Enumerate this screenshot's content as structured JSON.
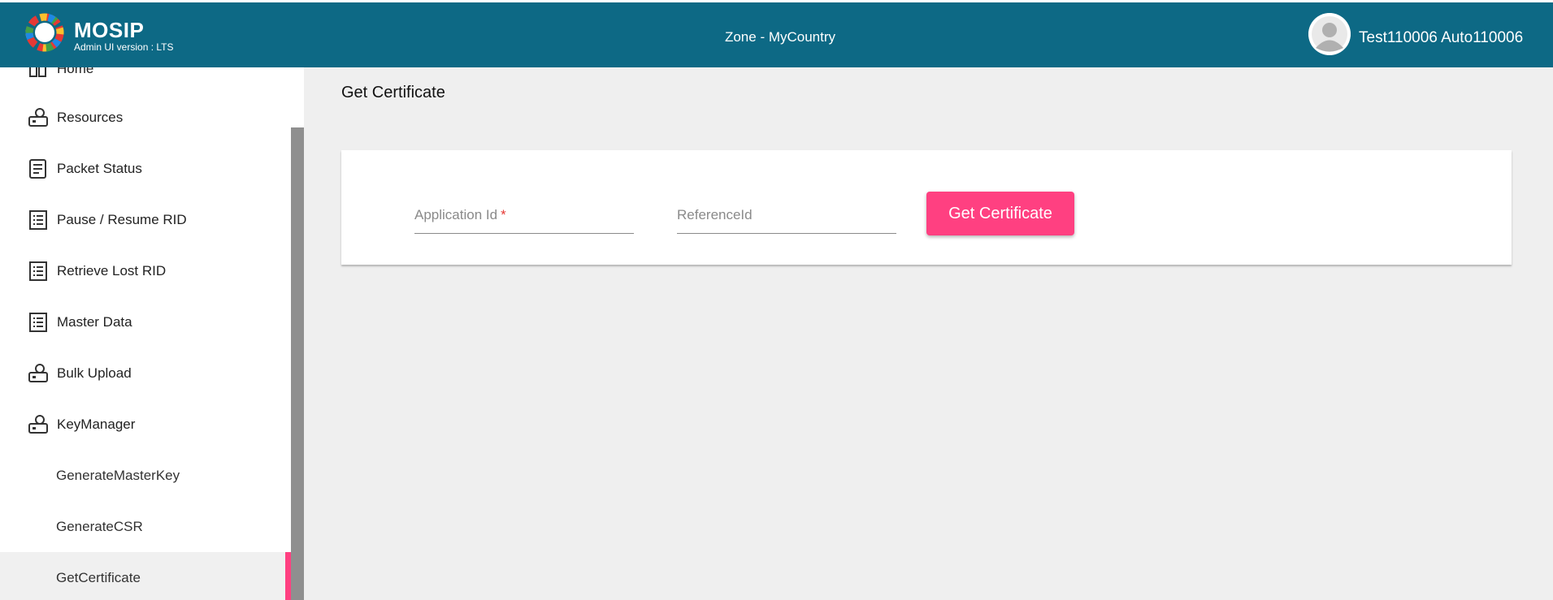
{
  "header": {
    "app_name": "MOSIP",
    "version_label": "Admin UI version : LTS",
    "zone_label": "Zone - MyCountry",
    "user_name": "Test110006 Auto110006"
  },
  "sidebar": {
    "items": [
      {
        "label": "Home",
        "icon": "home-icon"
      },
      {
        "label": "Resources",
        "icon": "resources-icon"
      },
      {
        "label": "Packet Status",
        "icon": "packet-status-icon"
      },
      {
        "label": "Pause / Resume RID",
        "icon": "list-icon"
      },
      {
        "label": "Retrieve Lost RID",
        "icon": "list-icon"
      },
      {
        "label": "Master Data",
        "icon": "list-icon"
      },
      {
        "label": "Bulk Upload",
        "icon": "bulk-upload-icon"
      },
      {
        "label": "KeyManager",
        "icon": "key-manager-icon"
      }
    ],
    "sub_items": [
      {
        "label": "GenerateMasterKey"
      },
      {
        "label": "GenerateCSR"
      },
      {
        "label": "GetCertificate",
        "active": true
      }
    ]
  },
  "main": {
    "page_title": "Get Certificate",
    "form": {
      "application_id_placeholder": "Application Id",
      "application_id_required": "*",
      "application_id_value": "",
      "reference_id_placeholder": "ReferenceId",
      "reference_id_value": "",
      "submit_label": "Get Certificate"
    }
  },
  "colors": {
    "header_bg": "#0d6985",
    "accent": "#ff4081",
    "main_bg": "#efefef"
  }
}
